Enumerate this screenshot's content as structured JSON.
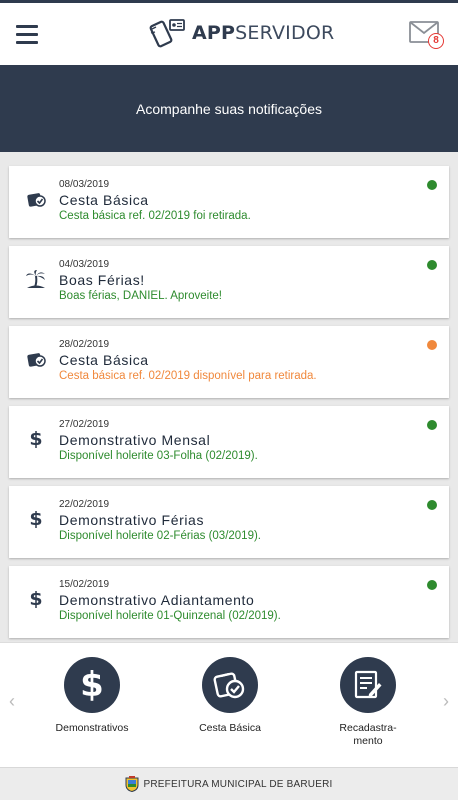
{
  "header": {
    "logo_bold": "APP",
    "logo_light": "SERVIDOR",
    "mail_badge": "8"
  },
  "banner": {
    "title": "Acompanhe suas notificações"
  },
  "notifications": [
    {
      "date": "08/03/2019",
      "title": "Cesta Básica",
      "message": "Cesta básica ref. 02/2019 foi retirada.",
      "icon": "basket-check-icon",
      "status_color": "#2e8b2e",
      "message_color": "#2e8b2e"
    },
    {
      "date": "04/03/2019",
      "title": "Boas Férias!",
      "message": "Boas férias, DANIEL. Aproveite!",
      "icon": "palm-tree-icon",
      "status_color": "#2e8b2e",
      "message_color": "#2e8b2e"
    },
    {
      "date": "28/02/2019",
      "title": "Cesta Básica",
      "message": "Cesta básica ref. 02/2019 disponível para retirada.",
      "icon": "basket-check-icon",
      "status_color": "#f0883c",
      "message_color": "#f0883c"
    },
    {
      "date": "27/02/2019",
      "title": "Demonstrativo Mensal",
      "message": "Disponível holerite 03-Folha (02/2019).",
      "icon": "dollar-icon",
      "status_color": "#2e8b2e",
      "message_color": "#2e8b2e"
    },
    {
      "date": "22/02/2019",
      "title": "Demonstrativo Férias",
      "message": "Disponível holerite 02-Férias (03/2019).",
      "icon": "dollar-icon",
      "status_color": "#2e8b2e",
      "message_color": "#2e8b2e"
    },
    {
      "date": "15/02/2019",
      "title": "Demonstrativo Adiantamento",
      "message": "Disponível holerite 01-Quinzenal (02/2019).",
      "icon": "dollar-icon",
      "status_color": "#2e8b2e",
      "message_color": "#2e8b2e"
    }
  ],
  "shortcuts": {
    "left_arrow": "‹",
    "right_arrow": "›",
    "items": [
      {
        "label": "Demonstrativos",
        "icon": "dollar-icon"
      },
      {
        "label": "Cesta Básica",
        "icon": "basket-check-icon"
      },
      {
        "label_line1": "Recadastra-",
        "label_line2": "mento",
        "icon": "form-edit-icon"
      }
    ]
  },
  "footer": {
    "text": "PREFEITURA MUNICIPAL DE BARUERI",
    "icon": "coat-of-arms-icon"
  },
  "colors": {
    "primary": "#2f3b4e",
    "green": "#2e8b2e",
    "orange": "#f0883c",
    "badge": "#e53935"
  }
}
